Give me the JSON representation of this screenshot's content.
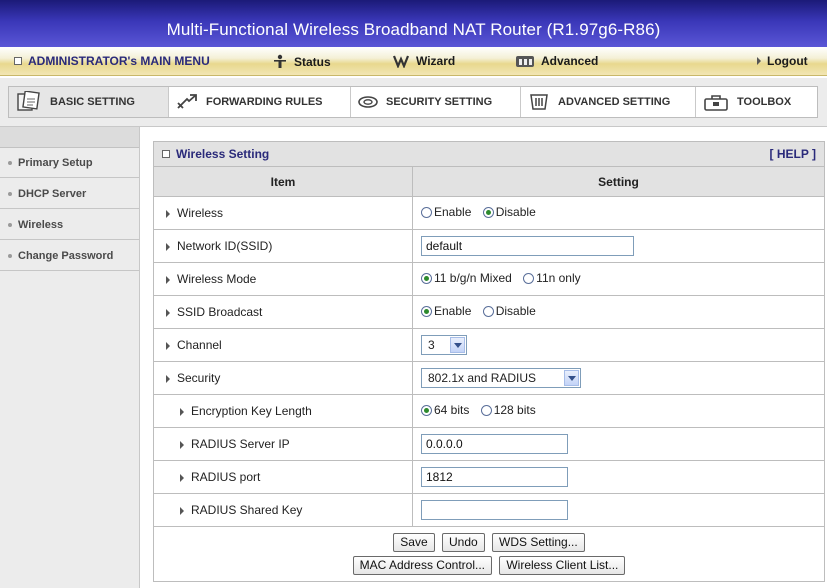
{
  "window": {
    "title": "Multi-Functional Wireless Broadband NAT Router (R1.97g6-R86)"
  },
  "main_menu": {
    "admin_label": "ADMINISTRATOR's MAIN MENU",
    "status_label": "Status",
    "wizard_label": "Wizard",
    "advanced_label": "Advanced",
    "logout_label": "Logout"
  },
  "tabs": {
    "basic": "BASIC SETTING",
    "forwarding": "FORWARDING RULES",
    "security": "SECURITY SETTING",
    "advanced": "ADVANCED SETTING",
    "toolbox": "TOOLBOX"
  },
  "sidebar": {
    "primary_setup": "Primary Setup",
    "dhcp_server": "DHCP Server",
    "wireless": "Wireless",
    "change_password": "Change Password"
  },
  "panel": {
    "title": "Wireless Setting",
    "help": "[ HELP ]",
    "col_item": "Item",
    "col_setting": "Setting"
  },
  "fields": {
    "wireless": {
      "label": "Wireless",
      "opt1": "Enable",
      "opt2": "Disable",
      "selected": "Disable"
    },
    "ssid": {
      "label": "Network ID(SSID)",
      "value": "default"
    },
    "mode": {
      "label": "Wireless Mode",
      "opt1": "11 b/g/n Mixed",
      "opt2": "11n only",
      "selected": "11 b/g/n Mixed"
    },
    "ssid_broadcast": {
      "label": "SSID Broadcast",
      "opt1": "Enable",
      "opt2": "Disable",
      "selected": "Enable"
    },
    "channel": {
      "label": "Channel",
      "value": "3"
    },
    "security": {
      "label": "Security",
      "value": "802.1x and RADIUS"
    },
    "key_length": {
      "label": "Encryption Key Length",
      "opt1": "64 bits",
      "opt2": "128 bits",
      "selected": "64 bits"
    },
    "radius_ip": {
      "label": "RADIUS Server IP",
      "value": "0.0.0.0"
    },
    "radius_port": {
      "label": "RADIUS port",
      "value": "1812"
    },
    "radius_key": {
      "label": "RADIUS Shared Key",
      "value": ""
    }
  },
  "buttons": {
    "save": "Save",
    "undo": "Undo",
    "wds": "WDS Setting...",
    "mac": "MAC Address Control...",
    "client_list": "Wireless Client List..."
  },
  "colors": {
    "title_bar": "#3a37b8",
    "menu_gold": "#e8d88e",
    "header_text": "#2a2a7a",
    "radio_on": "#2d8a2d"
  }
}
